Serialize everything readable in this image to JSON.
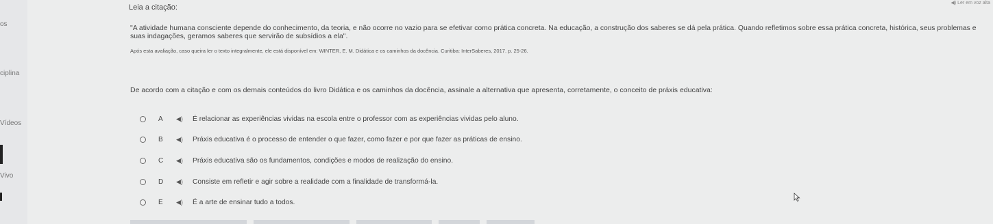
{
  "sidebar": {
    "items": [
      {
        "label": "os"
      },
      {
        "label": "ciplina"
      },
      {
        "label": "Vídeos"
      },
      {
        "label": "Vivo"
      }
    ]
  },
  "header": {
    "prompt": "Leia a citação:",
    "tts_label": "Ler em voz alta"
  },
  "quote": {
    "text": "\"A atividade humana consciente depende do conhecimento, da teoria, e não ocorre no vazio para se efetivar como prática concreta. Na educação, a construção dos saberes se dá pela prática. Quando refletimos sobre essa prática concreta, histórica, seus problemas e suas indagações, geramos saberes que servirão de subsídios a ela\".",
    "reference": "Após esta avaliação, caso queira ler o texto integralmente, ele está disponível em: WINTER, E. M. Didática e os caminhos da docência. Curitiba: InterSaberes, 2017. p. 25-26."
  },
  "question": {
    "text": "De acordo com a citação e com os demais conteúdos do livro Didática e os caminhos da docência, assinale a alternativa que apresenta, corretamente, o conceito de práxis educativa:"
  },
  "options": [
    {
      "letter": "A",
      "text": "É relacionar as experiências vividas na escola entre o professor com as experiências vividas pelo aluno."
    },
    {
      "letter": "B",
      "text": "Práxis educativa é o processo de entender o que fazer, como fazer e por que fazer as práticas de ensino."
    },
    {
      "letter": "C",
      "text": "Práxis educativa são os fundamentos, condições e modos de realização do ensino."
    },
    {
      "letter": "D",
      "text": "Consiste em refletir e agir sobre a realidade com a finalidade de transformá-la."
    },
    {
      "letter": "E",
      "text": "É a arte de ensinar tudo a todos."
    }
  ],
  "icons": {
    "speaker": "speaker-icon",
    "radio": "radio-icon",
    "cursor": "cursor-icon"
  }
}
